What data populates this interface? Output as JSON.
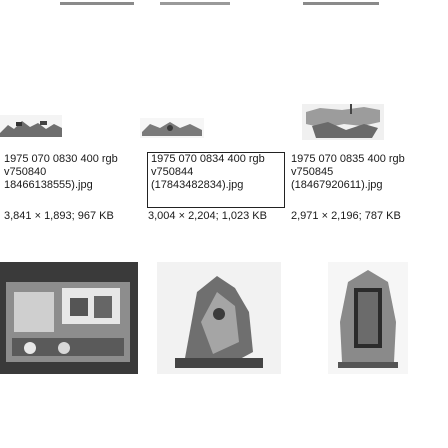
{
  "gallery": {
    "items": [
      {
        "caption_lines": [
          "1975 070 0830 400 rgb",
          "v750840",
          "18466138555).jpg"
        ],
        "size": "3,841 × 1,893; 967 KB",
        "selected": false
      },
      {
        "caption_lines": [
          "1975 070 0834 400 rgb",
          "v750844",
          "(17843482834).jpg"
        ],
        "size": "3,004 × 2,204; 1,023 KB",
        "selected": true
      },
      {
        "caption_lines": [
          "1975 070 0835 400 rgb",
          "v750845",
          "(18467920611).jpg"
        ],
        "size": "2,971 × 2,196; 787 KB",
        "selected": false
      }
    ]
  },
  "colors": {
    "text": "#1a1a1a",
    "selection_border": "#222222",
    "photo_bg": "#ffffff"
  }
}
